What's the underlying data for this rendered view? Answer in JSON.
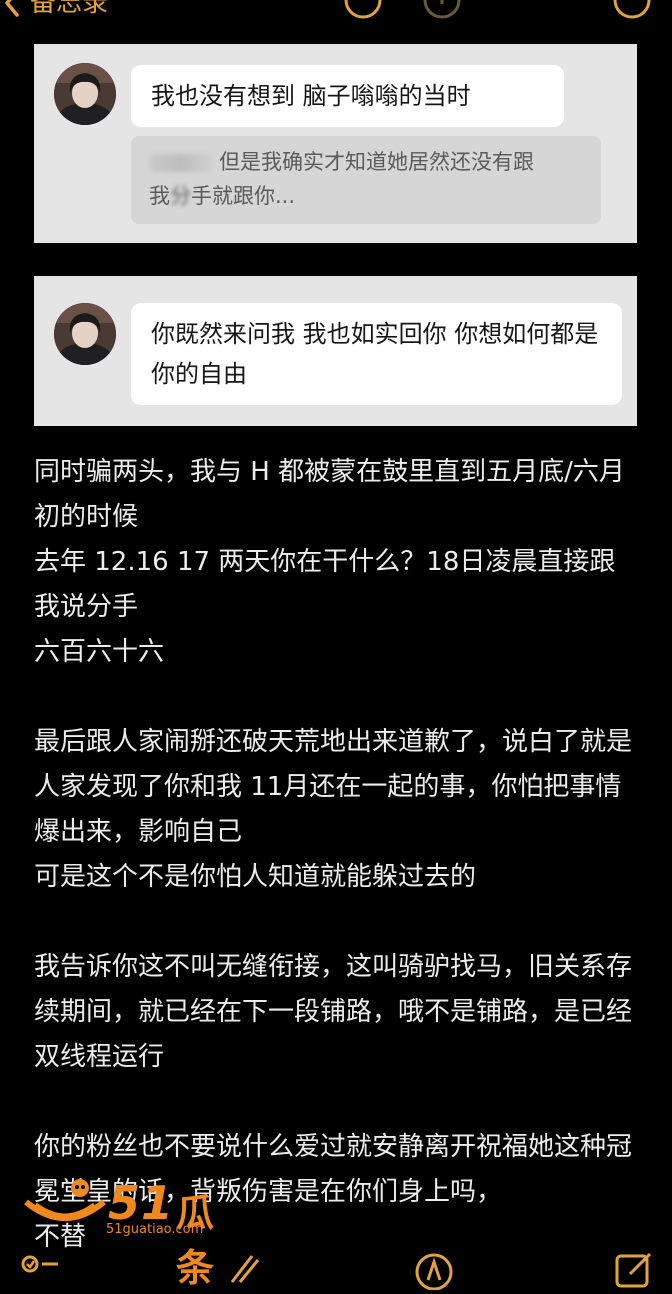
{
  "nav": {
    "back_label": "备忘录",
    "icons": [
      "share-icon",
      "more-circle-icon",
      "undo-icon",
      "export-icon",
      "ellipsis-icon"
    ]
  },
  "screenshot1": {
    "message": "我也没有想到 脑子嗡嗡的当时",
    "quote_line1": "但是我确实才知道她居然还没有跟",
    "quote_line2_a": "我",
    "quote_line2_blur": "分",
    "quote_line2_b": "手就跟你..."
  },
  "screenshot2": {
    "message": "你既然来问我 我也如实回你 你想如何都是你的自由"
  },
  "note": {
    "p1": "同时骗两头，我与 H 都被蒙在鼓里直到五月底/六月初的时候",
    "p2": "去年 12.16 17 两天你在干什么？18日凌晨直接跟我说分手",
    "p3": "六百六十六",
    "p4": "最后跟人家闹掰还破天荒地出来道歉了，说白了就是人家发现了你和我 11月还在一起的事，你怕把事情爆出来，影响自己",
    "p5": "可是这个不是你怕人知道就能躲过去的",
    "p6": "我告诉你这不叫无缝衔接，这叫骑驴找马，旧关系存续期间，就已经在下一段铺路，哦不是铺路，是已经双线程运行",
    "p7": "你的粉丝也不要说什么爱过就安静离开祝福她这种冠冕堂皇的话，背叛伤害是在你们身上吗，",
    "p8": "不替"
  },
  "watermark": {
    "number": "51",
    "text": "瓜条",
    "url": "51guatiao.com"
  },
  "toolbar": {
    "icons": [
      "checklist-icon",
      "pencil-icon",
      "compass-icon",
      "compose-icon"
    ]
  },
  "colors": {
    "accent": "#e3a33c",
    "background": "#000000",
    "card": "#e5e5e5",
    "bubble": "#ffffff",
    "quote": "#d6d6d6",
    "watermark": "#f0891c"
  }
}
